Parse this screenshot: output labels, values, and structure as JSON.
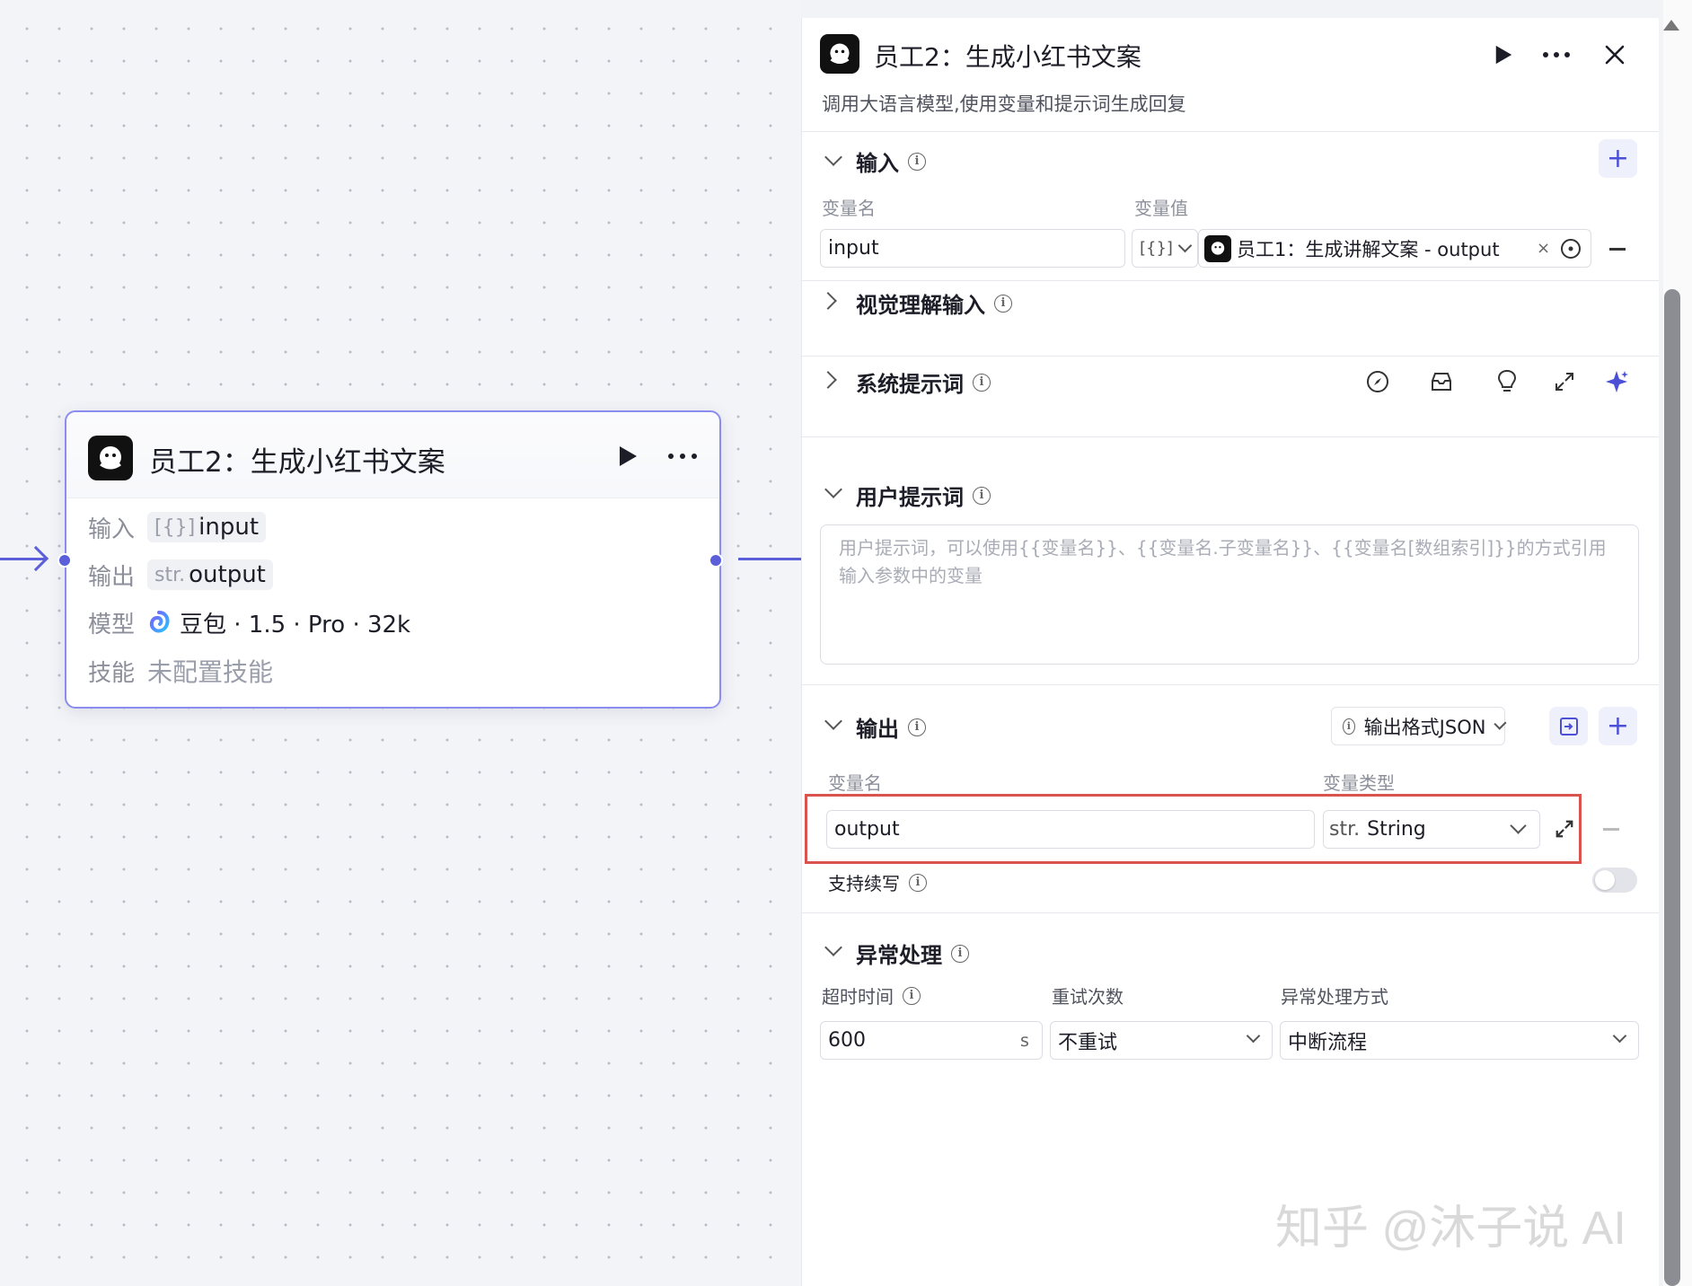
{
  "node": {
    "title": "员工2：生成小红书文案",
    "rows": {
      "input_label": "输入",
      "input_type": "[{}]",
      "input_value": "input",
      "output_label": "输出",
      "output_type": "str.",
      "output_value": "output",
      "model_label": "模型",
      "model_value": "豆包 · 1.5 · Pro · 32k",
      "skill_label": "技能",
      "skill_value": "未配置技能"
    }
  },
  "panel": {
    "title": "员工2：生成小红书文案",
    "description": "调用大语言模型,使用变量和提示词生成回复",
    "input_section": {
      "title": "输入",
      "col_name": "变量名",
      "col_value": "变量值",
      "name_value": "input",
      "type_prefix": "[{}]",
      "ref_value": "员工1：生成讲解文案 - output"
    },
    "vision_section": {
      "title": "视觉理解输入"
    },
    "system_prompt": {
      "title": "系统提示词"
    },
    "user_prompt": {
      "title": "用户提示词",
      "placeholder": "用户提示词，可以使用{{变量名}}、{{变量名.子变量名}}、{{变量名[数组索引]}}的方式引用输入参数中的变量"
    },
    "output_section": {
      "title": "输出",
      "format_label": "输出格式JSON",
      "col_name": "变量名",
      "col_type": "变量类型",
      "name_value": "output",
      "type_prefix": "str.",
      "type_value": "String",
      "continue_label": "支持续写"
    },
    "exception_section": {
      "title": "异常处理",
      "col_timeout": "超时时间",
      "col_retry": "重试次数",
      "col_method": "异常处理方式",
      "timeout_value": "600",
      "timeout_unit": "s",
      "retry_value": "不重试",
      "method_value": "中断流程"
    }
  },
  "watermark": "知乎 @沐子说 AI",
  "colors": {
    "accent": "#5b5fd9",
    "highlight": "#d9534f"
  }
}
